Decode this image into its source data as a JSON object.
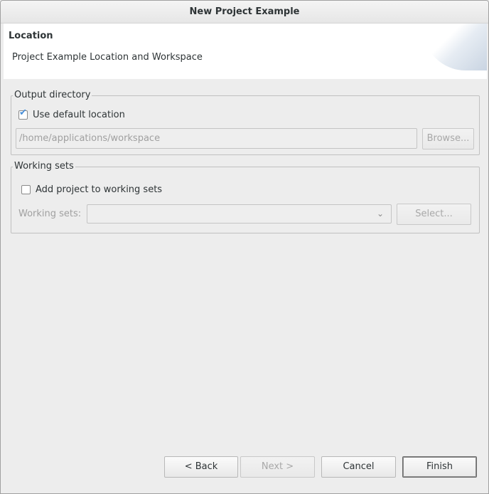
{
  "window": {
    "title": "New Project Example"
  },
  "banner": {
    "title": "Location",
    "description": "Project Example Location and Workspace"
  },
  "output_directory": {
    "legend": "Output directory",
    "use_default_label": "Use default location",
    "use_default_checked": true,
    "path_value": "/home/applications/workspace",
    "browse_label": "Browse..."
  },
  "working_sets": {
    "legend": "Working sets",
    "add_label": "Add project to working sets",
    "add_checked": false,
    "sets_label": "Working sets:",
    "sets_value": "",
    "select_label": "Select..."
  },
  "footer": {
    "back_label": "< Back",
    "next_label": "Next >",
    "cancel_label": "Cancel",
    "finish_label": "Finish"
  },
  "icons": {
    "checkmark": "check-icon",
    "dropdown": "chevron-down-icon"
  }
}
